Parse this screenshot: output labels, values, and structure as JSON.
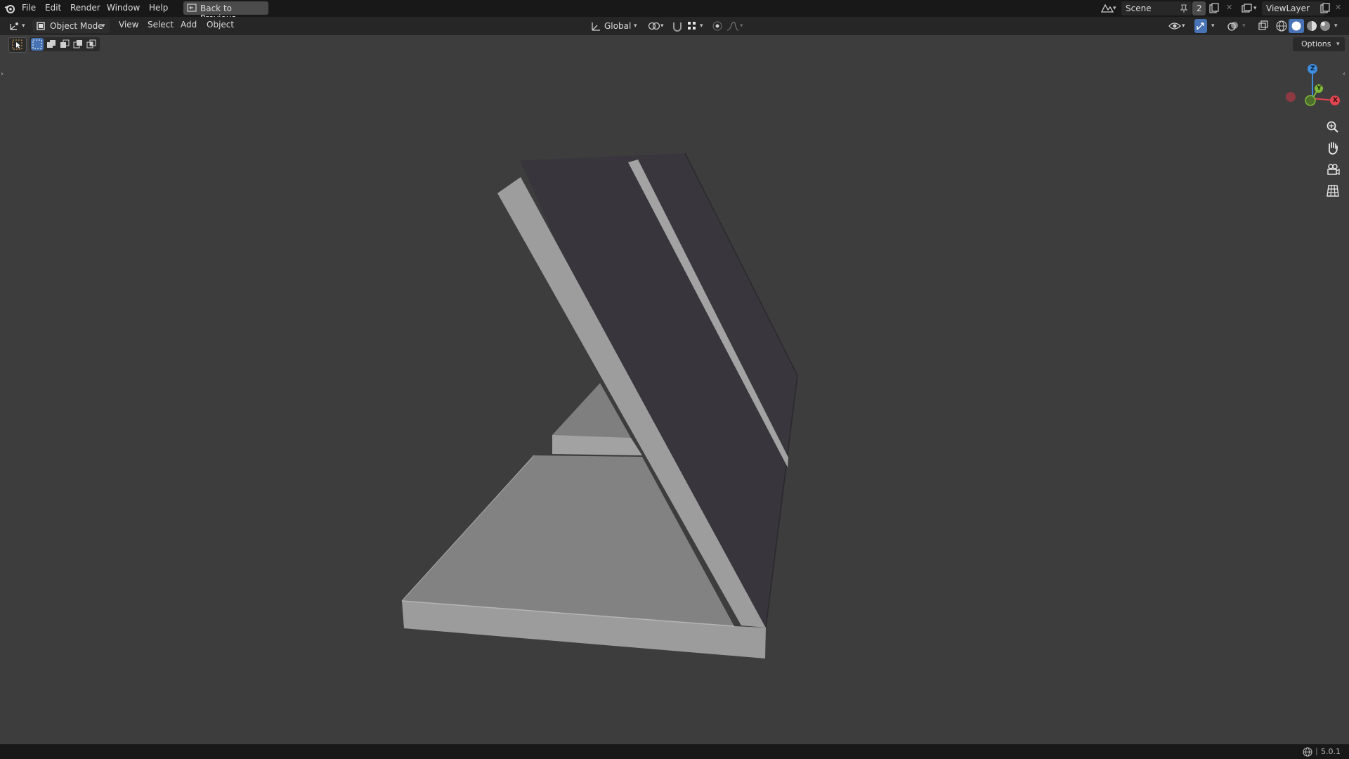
{
  "menubar": {
    "logo_icon": "blender-logo-icon",
    "items": [
      "File",
      "Edit",
      "Render",
      "Window",
      "Help"
    ],
    "back_button": "Back to Previous",
    "scene": "Scene",
    "scene_users": "2",
    "view_layer": "ViewLayer"
  },
  "header": {
    "editor_type_icon": "3d-viewport-icon",
    "mode": "Object Mode",
    "menus": [
      "View",
      "Select",
      "Add",
      "Object"
    ],
    "transform_orientation": "Global",
    "icons": [
      "pivot-icon",
      "snap-icon",
      "snap-increment-icon",
      "proportional-edit-icon",
      "falloff-icon",
      "visibility-icon",
      "gizmo-icon",
      "overlay-icon",
      "xray-icon",
      "wireframe-shading-icon",
      "solid-shading-icon",
      "material-shading-icon",
      "rendered-shading-icon"
    ]
  },
  "tool_header": {
    "options": "Options",
    "select_modes": [
      "select-box-icon",
      "select-new-icon",
      "select-extend-icon",
      "select-subtract-icon",
      "select-intersect-icon"
    ]
  },
  "navigation": {
    "gizmo_axes": [
      "X",
      "Y",
      "Z"
    ],
    "buttons": [
      "zoom-icon",
      "pan-hand-icon",
      "camera-view-icon",
      "ortho-grid-icon"
    ]
  },
  "statusbar": {
    "version": "5.0.1"
  },
  "colors": {
    "x_axis": "#e0444f",
    "y_axis": "#7fb93a",
    "z_axis": "#3f8ddf",
    "active_blue": "#4772b3"
  }
}
